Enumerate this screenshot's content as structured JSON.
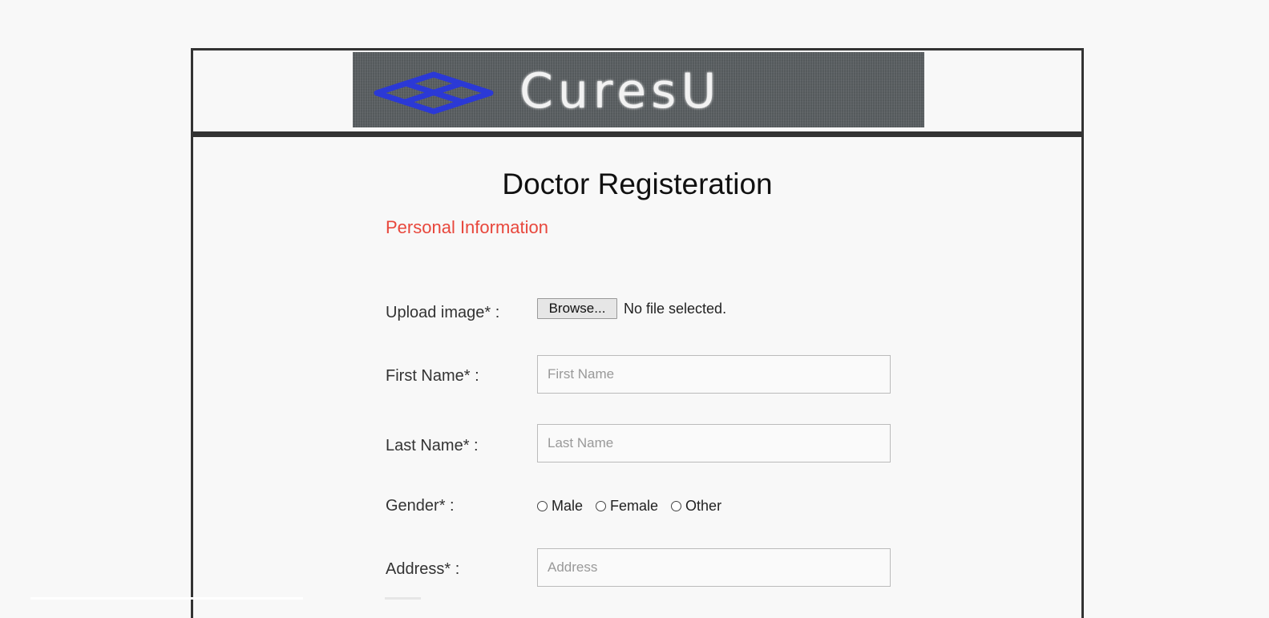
{
  "header": {
    "logo_text": "CuresU",
    "logo_icon": "cube-icon",
    "logo_icon_color": "#2b39d6"
  },
  "form": {
    "title": "Doctor Registeration",
    "section_heading": "Personal Information",
    "section_color": "#e8473c",
    "upload": {
      "label": "Upload image* :",
      "button_label": "Browse...",
      "status": "No file selected."
    },
    "first_name": {
      "label": "First Name* :",
      "placeholder": "First Name",
      "value": ""
    },
    "last_name": {
      "label": "Last Name* :",
      "placeholder": "Last Name",
      "value": ""
    },
    "gender": {
      "label": "Gender* :",
      "options": [
        "Male",
        "Female",
        "Other"
      ]
    },
    "address": {
      "label": "Address* :",
      "placeholder": "Address",
      "value": ""
    }
  }
}
